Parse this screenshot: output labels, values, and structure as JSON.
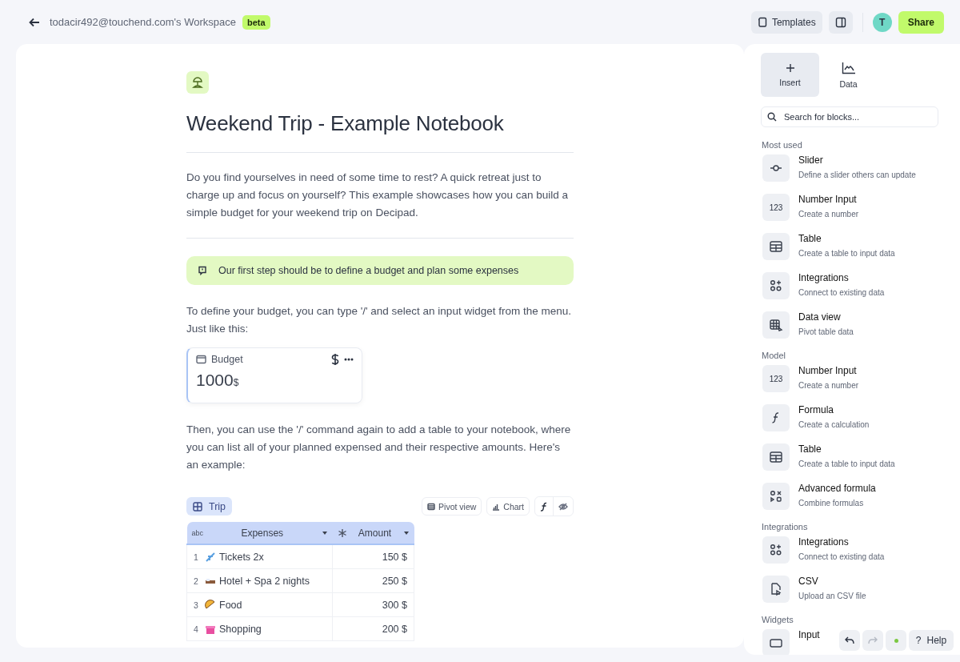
{
  "top_bar": {
    "workspace": "todacir492@touchend.com's Workspace",
    "badge": "beta",
    "templates": "Templates",
    "avatar": "T",
    "share": "Share"
  },
  "notebook": {
    "title": "Weekend Trip - Example Notebook",
    "intro": "Do you find yourselves in need of some time to rest? A quick retreat just to charge up and focus on yourself? This example showcases how you can build a simple budget for your weekend trip on Decipad.",
    "callout": "Our first step should be to define a budget and plan some expenses",
    "budget_intro": "To define your budget, you can type '/' and select an input widget from the menu. Just like this:",
    "budget": {
      "label": "Budget",
      "value": "1000",
      "unit": "$"
    },
    "table_intro": "Then, you can use the '/' command again to add a table to your notebook, where you can list all of your planned expensed and their respective amounts. Here's an example:",
    "table": {
      "name": "Trip",
      "views": [
        "Pivot view",
        "Chart"
      ],
      "columns": [
        {
          "type_label": "abc",
          "name": "Expenses"
        },
        {
          "name": "Amount"
        }
      ],
      "rows": [
        {
          "index": "1",
          "kind": "plane",
          "name": "Tickets 2x",
          "amount": "150 $"
        },
        {
          "index": "2",
          "kind": "bed",
          "name": "Hotel + Spa 2 nights",
          "amount": "250 $"
        },
        {
          "index": "3",
          "kind": "taco",
          "name": "Food",
          "amount": "300 $"
        },
        {
          "index": "4",
          "kind": "gift",
          "name": "Shopping",
          "amount": "200 $"
        }
      ]
    }
  },
  "sidebar": {
    "tabs": [
      {
        "label": "Insert",
        "kind": "plus",
        "selected": true
      },
      {
        "label": "Data",
        "kind": "chart",
        "selected": false
      }
    ],
    "search": {
      "placeholder": "Search for blocks..."
    },
    "sections": [
      {
        "title": "Most used",
        "items": [
          {
            "kind": "slider",
            "title": "Slider",
            "description": "Define a slider others can update"
          },
          {
            "kind": "number",
            "title": "Number Input",
            "description": "Create a number",
            "icon_text": "123"
          },
          {
            "kind": "table",
            "title": "Table",
            "description": "Create a table to input data"
          },
          {
            "kind": "integrations",
            "title": "Integrations",
            "description": "Connect to existing data"
          },
          {
            "kind": "dataview",
            "title": "Data view",
            "description": "Pivot table data"
          }
        ]
      },
      {
        "title": "Model",
        "items": [
          {
            "kind": "number",
            "title": "Number Input",
            "description": "Create a number",
            "icon_text": "123"
          },
          {
            "kind": "formula",
            "title": "Formula",
            "description": "Create a calculation"
          },
          {
            "kind": "table",
            "title": "Table",
            "description": "Create a table to input data"
          },
          {
            "kind": "advanced",
            "title": "Advanced formula",
            "description": "Combine formulas"
          }
        ]
      },
      {
        "title": "Integrations",
        "items": [
          {
            "kind": "integrations",
            "title": "Integrations",
            "description": "Connect to existing data"
          },
          {
            "kind": "csv",
            "title": "CSV",
            "description": "Upload an CSV file"
          }
        ]
      },
      {
        "title": "Widgets",
        "items": [
          {
            "kind": "input",
            "title": "Input"
          }
        ]
      }
    ]
  },
  "toolbar": {
    "help": "Help",
    "help_glyph": "?"
  }
}
